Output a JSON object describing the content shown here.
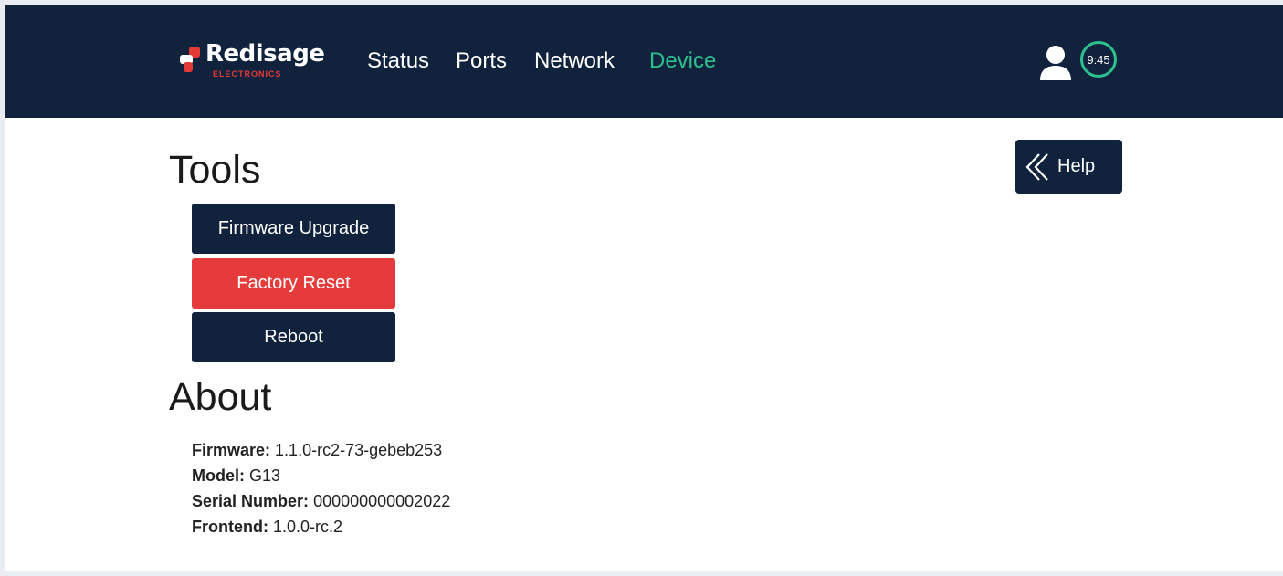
{
  "brand": {
    "name": "Redisage",
    "subtitle": "ELECTRONICS",
    "accent_color": "#e53935"
  },
  "nav": {
    "items": [
      {
        "label": "Status",
        "active": false
      },
      {
        "label": "Ports",
        "active": false
      },
      {
        "label": "Network",
        "active": false
      },
      {
        "label": "Device",
        "active": true
      }
    ],
    "active_color": "#2fbf8f"
  },
  "header": {
    "user_icon": "user-icon",
    "timer": "9:45"
  },
  "help": {
    "label": "Help",
    "icon": "double-chevron-left-icon"
  },
  "tools": {
    "title": "Tools",
    "buttons": {
      "firmware_upgrade": "Firmware Upgrade",
      "factory_reset": "Factory Reset",
      "reboot": "Reboot"
    },
    "danger_color": "#e63b3b",
    "dark_color": "#11223d"
  },
  "about": {
    "title": "About",
    "rows": [
      {
        "label": "Firmware:",
        "value": "1.1.0-rc2-73-gebeb253"
      },
      {
        "label": "Model:",
        "value": "G13"
      },
      {
        "label": "Serial Number:",
        "value": "000000000002022"
      },
      {
        "label": "Frontend:",
        "value": "1.0.0-rc.2"
      }
    ]
  }
}
